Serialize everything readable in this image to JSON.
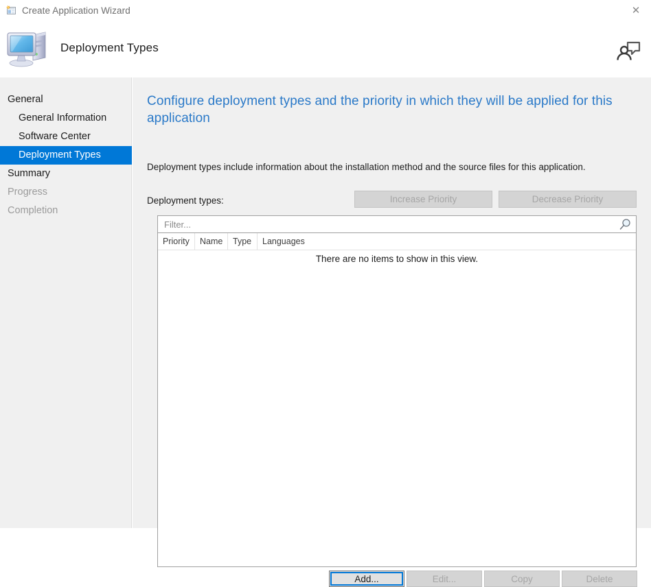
{
  "window": {
    "title": "Create Application Wizard",
    "icon": "application-wizard-icon",
    "close_label": "✕"
  },
  "header": {
    "title": "Deployment Types",
    "icon": "computer-icon",
    "help_icon": "person-feedback-icon"
  },
  "sidebar": {
    "items": [
      {
        "label": "General",
        "level": "parent",
        "state": "normal"
      },
      {
        "label": "General Information",
        "level": "child",
        "state": "normal"
      },
      {
        "label": "Software Center",
        "level": "child",
        "state": "normal"
      },
      {
        "label": "Deployment Types",
        "level": "child",
        "state": "selected"
      },
      {
        "label": "Summary",
        "level": "parent",
        "state": "normal"
      },
      {
        "label": "Progress",
        "level": "parent",
        "state": "disabled"
      },
      {
        "label": "Completion",
        "level": "parent",
        "state": "disabled"
      }
    ]
  },
  "main": {
    "heading": "Configure deployment types and the priority in which they will be applied for this application",
    "description": "Deployment types include information about the installation method and the source files for this application.",
    "list_label": "Deployment types:",
    "increase_priority_label": "Increase Priority",
    "decrease_priority_label": "Decrease Priority",
    "filter": {
      "value": "",
      "placeholder": "Filter...",
      "search_icon": "magnifier-icon"
    },
    "list": {
      "columns": [
        "Priority",
        "Name",
        "Type",
        "Languages"
      ],
      "rows": [],
      "empty_message": "There are no items to show in this view."
    },
    "actions": {
      "add_label": "Add...",
      "edit_label": "Edit...",
      "copy_label": "Copy",
      "delete_label": "Delete"
    }
  },
  "colors": {
    "accent": "#0078d7",
    "heading": "#2a79c8",
    "body_bg": "#f0f0f0",
    "disabled_text": "#a6a6a6"
  }
}
